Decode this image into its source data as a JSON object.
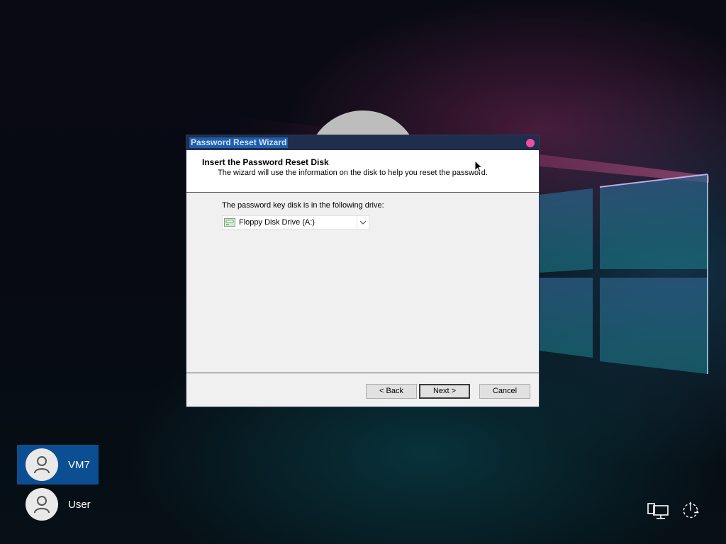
{
  "dialog": {
    "title": "Password Reset Wizard",
    "header_title": "Insert the Password Reset Disk",
    "header_subtitle": "The wizard will use the information on the disk to help you reset the password.",
    "drive_label": "The password key disk is in the following drive:",
    "drive_value": "Floppy Disk Drive (A:)",
    "buttons": {
      "back": "< Back",
      "next": "Next >",
      "cancel": "Cancel"
    }
  },
  "users": [
    {
      "name": "VM7",
      "selected": true
    },
    {
      "name": "User",
      "selected": false
    }
  ],
  "tray": {
    "network_icon": "network-icon",
    "power_icon": "ease-of-access-icon"
  },
  "colors": {
    "title_bar": "#1f2e4d",
    "close_button": "#f04ca0",
    "selected_user": "#0b4f92"
  }
}
